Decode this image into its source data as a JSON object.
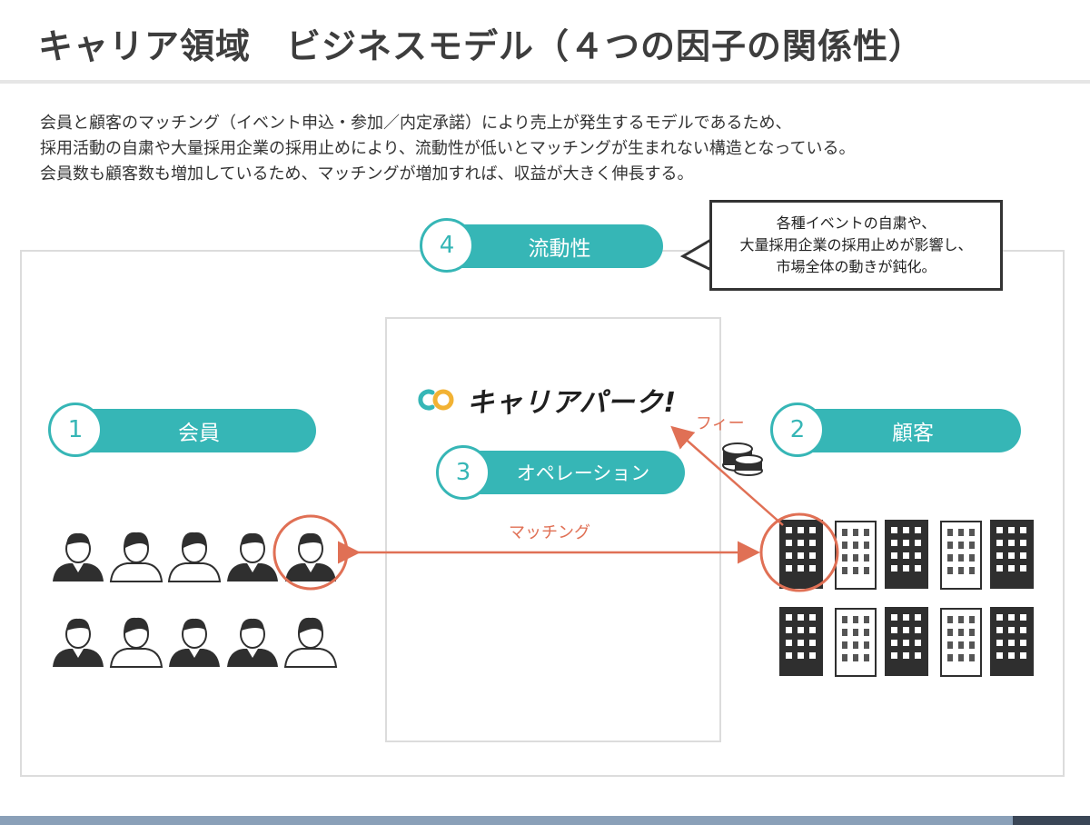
{
  "title": "キャリア領域　ビジネスモデル（４つの因子の関係性）",
  "intro": [
    "会員と顧客のマッチング（イベント申込・参加／内定承諾）により売上が発生するモデルであるため、",
    "採用活動の自粛や大量採用企業の採用止めにより、流動性が低いとマッチングが生まれない構造となっている。",
    "会員数も顧客数も増加しているため、マッチングが増加すれば、収益が大きく伸長する。"
  ],
  "factors": {
    "liquidity": {
      "number": "4",
      "label": "流動性"
    },
    "members": {
      "number": "1",
      "label": "会員"
    },
    "customers": {
      "number": "2",
      "label": "顧客"
    },
    "operation": {
      "number": "3",
      "label": "オペレーション"
    }
  },
  "callout": [
    "各種イベントの自粛や、",
    "大量採用企業の採用止めが影響し、",
    "市場全体の動きが鈍化。"
  ],
  "logo": {
    "text": "キャリアパーク!"
  },
  "labels": {
    "fee": "フィー",
    "matching": "マッチング"
  },
  "colors": {
    "accent": "#36b6b6",
    "highlight": "#e07055",
    "dark": "#2f2f2f"
  },
  "icons": {
    "people": "person-icon",
    "buildings": "building-icon",
    "coins": "coin-stack-icon"
  }
}
